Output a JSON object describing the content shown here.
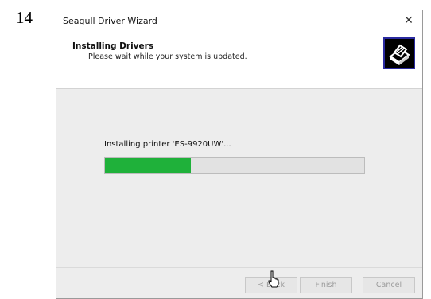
{
  "step_number": "14",
  "window": {
    "title": "Seagull Driver Wizard",
    "close_glyph": "✕",
    "close_icon": "close-icon"
  },
  "header": {
    "title": "Installing Drivers",
    "subtitle": "Please wait while your system is updated.",
    "logo_icon": "printer-icon"
  },
  "body": {
    "status_text": "Installing printer 'ES-9920UW'...",
    "progress_percent": 33,
    "progress_color": "#1fb13a"
  },
  "footer": {
    "back_label": "< Back",
    "finish_label": "Finish",
    "cancel_label": "Cancel",
    "buttons_enabled": false
  },
  "cursor_icon": "hand-pointer-icon"
}
